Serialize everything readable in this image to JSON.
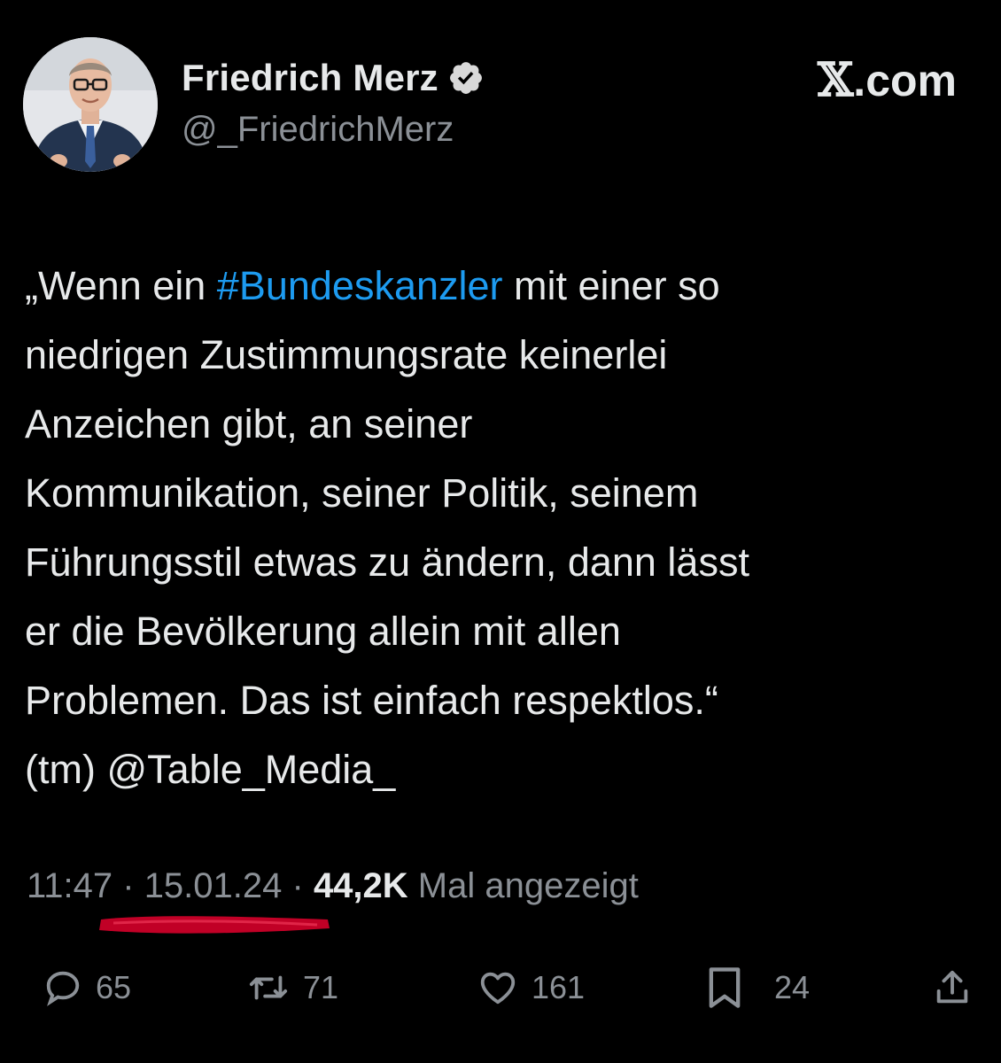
{
  "author": {
    "display_name": "Friedrich Merz",
    "handle": "@_FriedrichMerz",
    "verified_icon": "verified-badge-icon"
  },
  "brand": {
    "logo_text": "𝕏",
    "domain_suffix": ".com"
  },
  "tweet": {
    "text_before_hashtag": "„Wenn ein ",
    "hashtag": "#Bundeskanzler",
    "text_after_hashtag": " mit einer so\nniedrigen Zustimmungsrate keinerlei\nAnzeichen gibt, an seiner\nKommunikation, seiner Politik, seinem\nFührungsstil etwas zu ändern, dann lässt\ner die Bevölkerung allein mit allen\nProblemen. Das ist einfach respektlos.“\n(tm) @Table_Media_"
  },
  "meta": {
    "time": "11:47",
    "separator": " · ",
    "date": "15.01.24",
    "views": "44,2K",
    "views_label": " Mal angezeigt"
  },
  "actions": {
    "reply_count": "65",
    "retweet_count": "71",
    "like_count": "161",
    "bookmark_count": "24"
  },
  "colors": {
    "background": "#000000",
    "text": "#e7e9ea",
    "secondary": "#8b9096",
    "hashtag": "#1d9bf0",
    "verified_badge": "#d9d9d9",
    "red_underline": "#d6002a"
  }
}
